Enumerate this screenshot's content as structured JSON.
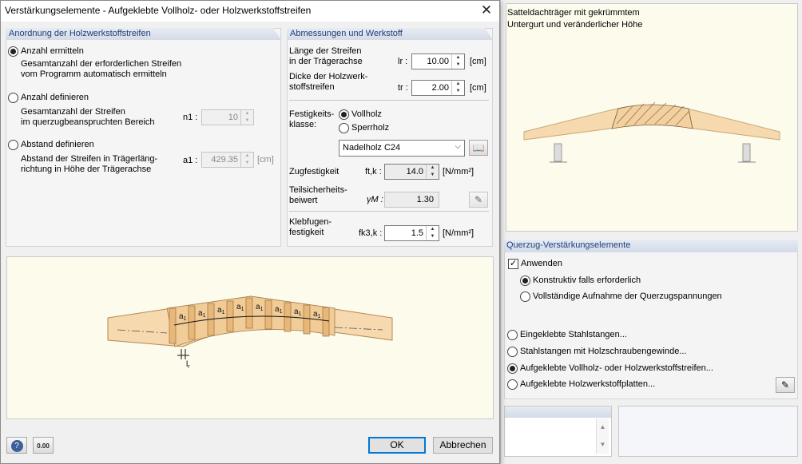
{
  "dialog": {
    "title": "Verstärkungselemente - Aufgeklebte Vollholz- oder Holzwerkstoffstreifen",
    "arrangement": {
      "header": "Anordnung der Holzwerkstoffstreifen",
      "options": [
        {
          "label": "Anzahl ermitteln",
          "description": "Gesamtanzahl der erforderlichen Streifen\nvom Programm automatisch ermitteln",
          "selected": true
        },
        {
          "label": "Anzahl definieren",
          "description": "Gesamtanzahl der Streifen\nim querzugbeanspruchten Bereich",
          "selected": false,
          "symbol": "n1 :",
          "value": "10"
        },
        {
          "label": "Abstand definieren",
          "description": "Abstand der Streifen in Trägerläng-\nrichtung in Höhe der Trägerachse",
          "selected": false,
          "symbol": "a1 :",
          "value": "429.35",
          "unit": "[cm]"
        }
      ]
    },
    "dimensions": {
      "header": "Abmessungen und Werkstoff",
      "length": {
        "label": "Länge der Streifen\nin der Trägerachse",
        "symbol": "lr :",
        "value": "10.00",
        "unit": "[cm]"
      },
      "thickness": {
        "label": "Dicke der Holzwerk-\nstoffstreifen",
        "symbol": "tr :",
        "value": "2.00",
        "unit": "[cm]"
      },
      "strength_class": {
        "label": "Festigkeits-\nklasse:",
        "options": [
          {
            "label": "Vollholz",
            "selected": true
          },
          {
            "label": "Sperrholz",
            "selected": false
          }
        ],
        "material": "Nadelholz C24"
      },
      "tensile": {
        "label": "Zugfestigkeit",
        "symbol": "ft,k :",
        "value": "14.0",
        "unit": "[N/mm²]"
      },
      "safety": {
        "label": "Teilsicherheits-\nbeiwert",
        "symbol": "γM :",
        "value": "1.30"
      },
      "glue": {
        "label": "Klebfugen-\nfestigkeit",
        "symbol": "fk3,k :",
        "value": "1.5",
        "unit": "[N/mm²]"
      }
    },
    "drawing": {
      "segment_label": "a1",
      "length_label": "lr"
    },
    "buttons": {
      "ok": "OK",
      "cancel": "Abbrechen"
    },
    "footer_icons": [
      "help-icon",
      "units-icon"
    ]
  },
  "background": {
    "preview_title": "Satteldachträger mit gekrümmtem\nUntergurt und veränderlicher Höhe",
    "panel": {
      "header": "Querzug-Verstärkungselemente",
      "apply": {
        "label": "Anwenden",
        "checked": true
      },
      "sub_options": [
        {
          "label": "Konstruktiv falls erforderlich",
          "selected": true
        },
        {
          "label": "Vollständige Aufnahme der Querzugspannungen",
          "selected": false
        }
      ],
      "types": [
        {
          "label": "Eingeklebte Stahlstangen...",
          "selected": false
        },
        {
          "label": "Stahlstangen mit Holzschraubengewinde...",
          "selected": false
        },
        {
          "label": "Aufgeklebte Vollholz- oder Holzwerkstoffstreifen...",
          "selected": true
        },
        {
          "label": "Aufgeklebte Holzwerkstoffplatten...",
          "selected": false
        }
      ]
    }
  },
  "colors": {
    "accent": "#0078d7",
    "group_header_text": "#1c3f7a",
    "wood": "#f6d9ae",
    "drawing_bg": "#fdfbec"
  }
}
